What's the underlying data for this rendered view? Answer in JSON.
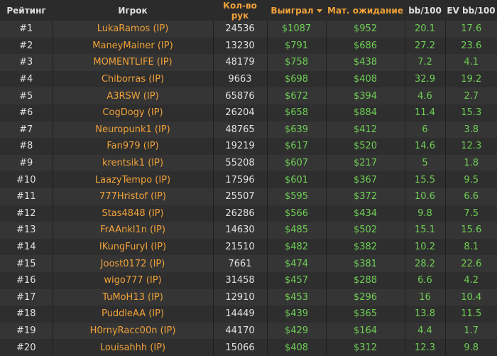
{
  "table": {
    "headers": {
      "rank": "Рейтинг",
      "player": "Игрок",
      "hands": "Кол-во рук",
      "won": "Выиграл",
      "ev": "Мат. ожидание",
      "bb100": "bb/100",
      "evbb100": "EV bb/100"
    },
    "sort_column": "won",
    "rows": [
      {
        "rank": "#1",
        "player": "LukaRamos (IP)",
        "hands": "24536",
        "won": "$1087",
        "ev": "$952",
        "bb": "20.1",
        "evbb": "17.6"
      },
      {
        "rank": "#2",
        "player": "ManeyMainer (IP)",
        "hands": "13230",
        "won": "$791",
        "ev": "$686",
        "bb": "27.2",
        "evbb": "23.6"
      },
      {
        "rank": "#3",
        "player": "MOMENTLIFE (IP)",
        "hands": "48179",
        "won": "$758",
        "ev": "$438",
        "bb": "7.2",
        "evbb": "4.1"
      },
      {
        "rank": "#4",
        "player": "Chiborras (IP)",
        "hands": "9663",
        "won": "$698",
        "ev": "$408",
        "bb": "32.9",
        "evbb": "19.2"
      },
      {
        "rank": "#5",
        "player": "A3RSW (IP)",
        "hands": "65876",
        "won": "$672",
        "ev": "$394",
        "bb": "4.6",
        "evbb": "2.7"
      },
      {
        "rank": "#6",
        "player": "CogDogy (IP)",
        "hands": "26204",
        "won": "$658",
        "ev": "$884",
        "bb": "11.4",
        "evbb": "15.3"
      },
      {
        "rank": "#7",
        "player": "Neuropunk1 (IP)",
        "hands": "48765",
        "won": "$639",
        "ev": "$412",
        "bb": "6",
        "evbb": "3.8"
      },
      {
        "rank": "#8",
        "player": "Fan979 (IP)",
        "hands": "19219",
        "won": "$617",
        "ev": "$520",
        "bb": "14.6",
        "evbb": "12.3"
      },
      {
        "rank": "#9",
        "player": "krentsik1 (IP)",
        "hands": "55208",
        "won": "$607",
        "ev": "$217",
        "bb": "5",
        "evbb": "1.8"
      },
      {
        "rank": "#10",
        "player": "LaazyTempo (IP)",
        "hands": "17596",
        "won": "$601",
        "ev": "$367",
        "bb": "15.5",
        "evbb": "9.5"
      },
      {
        "rank": "#11",
        "player": "777Hristof (IP)",
        "hands": "25507",
        "won": "$595",
        "ev": "$372",
        "bb": "10.6",
        "evbb": "6.6"
      },
      {
        "rank": "#12",
        "player": "Stas4848 (IP)",
        "hands": "26286",
        "won": "$566",
        "ev": "$434",
        "bb": "9.8",
        "evbb": "7.5"
      },
      {
        "rank": "#13",
        "player": "FrAAnkl1n (IP)",
        "hands": "14630",
        "won": "$485",
        "ev": "$502",
        "bb": "15.1",
        "evbb": "15.6"
      },
      {
        "rank": "#14",
        "player": "IKungFuryI (IP)",
        "hands": "21510",
        "won": "$482",
        "ev": "$382",
        "bb": "10.2",
        "evbb": "8.1"
      },
      {
        "rank": "#15",
        "player": "Joost0172 (IP)",
        "hands": "7661",
        "won": "$474",
        "ev": "$381",
        "bb": "28.2",
        "evbb": "22.6"
      },
      {
        "rank": "#16",
        "player": "wigo777 (IP)",
        "hands": "31458",
        "won": "$457",
        "ev": "$288",
        "bb": "6.6",
        "evbb": "4.2"
      },
      {
        "rank": "#17",
        "player": "TuMoH13 (IP)",
        "hands": "12910",
        "won": "$453",
        "ev": "$296",
        "bb": "16",
        "evbb": "10.4"
      },
      {
        "rank": "#18",
        "player": "PuddleAA (IP)",
        "hands": "14449",
        "won": "$439",
        "ev": "$365",
        "bb": "13.8",
        "evbb": "11.5"
      },
      {
        "rank": "#19",
        "player": "H0rnyRacc00n (IP)",
        "hands": "44170",
        "won": "$429",
        "ev": "$164",
        "bb": "4.4",
        "evbb": "1.7"
      },
      {
        "rank": "#20",
        "player": "Louisahhh (IP)",
        "hands": "15066",
        "won": "$408",
        "ev": "$312",
        "bb": "12.3",
        "evbb": "9.8"
      }
    ]
  },
  "colors": {
    "accent": "#f0a23a",
    "positive": "#6fcf55"
  }
}
